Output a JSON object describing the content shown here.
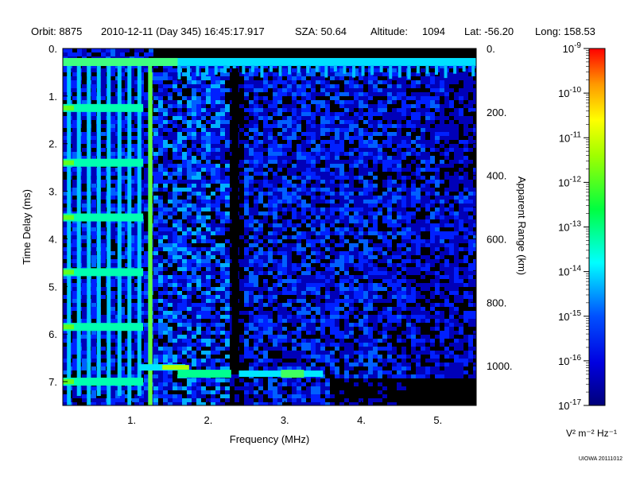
{
  "header": {
    "orbit": "Orbit: 8875",
    "datetime": "2010-12-11 (Day 345) 16:45:17.917",
    "sza": "SZA:  50.64",
    "altitude": "Altitude:     1094",
    "lat": "Lat: -56.20",
    "long": "Long: 158.53"
  },
  "colorbar": {
    "ticks": [
      {
        "base": "10",
        "exp": "-9"
      },
      {
        "base": "10",
        "exp": "-10"
      },
      {
        "base": "10",
        "exp": "-11"
      },
      {
        "base": "10",
        "exp": "-12"
      },
      {
        "base": "10",
        "exp": "-13"
      },
      {
        "base": "10",
        "exp": "-14"
      },
      {
        "base": "10",
        "exp": "-15"
      },
      {
        "base": "10",
        "exp": "-16"
      },
      {
        "base": "10",
        "exp": "-17"
      }
    ],
    "units": "V² m⁻² Hz⁻¹",
    "colors": [
      "#ff0000",
      "#ff8800",
      "#ffff00",
      "#00ff00",
      "#00ffff",
      "#0000ff",
      "#000080"
    ]
  },
  "credit": "UIOWA 20111012",
  "chart_data": {
    "type": "heatmap",
    "xlabel": "Frequency (MHz)",
    "ylabel": "Time Delay (ms)",
    "y2label": "Apparent Range (km)",
    "xlim": [
      0.1,
      5.5
    ],
    "ylim": [
      0,
      7.5
    ],
    "y_inverted": true,
    "x_ticks": [
      1,
      2,
      3,
      4,
      5
    ],
    "x_tick_labels": [
      "1.",
      "2.",
      "3.",
      "4.",
      "5."
    ],
    "y_ticks": [
      0,
      1,
      2,
      3,
      4,
      5,
      6,
      7
    ],
    "y_tick_labels": [
      "0.",
      "1.",
      "2.",
      "3.",
      "4.",
      "5.",
      "6.",
      "7."
    ],
    "y2_ticks_km": [
      0,
      200,
      400,
      600,
      800,
      1000
    ],
    "y2_tick_labels": [
      "0.",
      "200.",
      "400.",
      "600.",
      "800.",
      "1000."
    ],
    "zscale": "log",
    "zlim": [
      1e-17,
      1e-09
    ],
    "features": {
      "top_echo_delay_ms": 0.3,
      "bottom_echo_delay_ms": 6.75,
      "bottom_echo_freq_mhz": [
        1.1,
        3.5
      ],
      "harmonic_line_freqs_mhz": [
        0.18,
        0.31,
        0.44,
        0.57,
        0.7,
        0.84,
        0.97,
        1.1,
        1.24
      ],
      "horizontal_echo_delays_ms": [
        1.25,
        2.4,
        3.55,
        4.7,
        5.85,
        7.0
      ],
      "vertical_gap_freq_mhz": 2.35
    }
  }
}
